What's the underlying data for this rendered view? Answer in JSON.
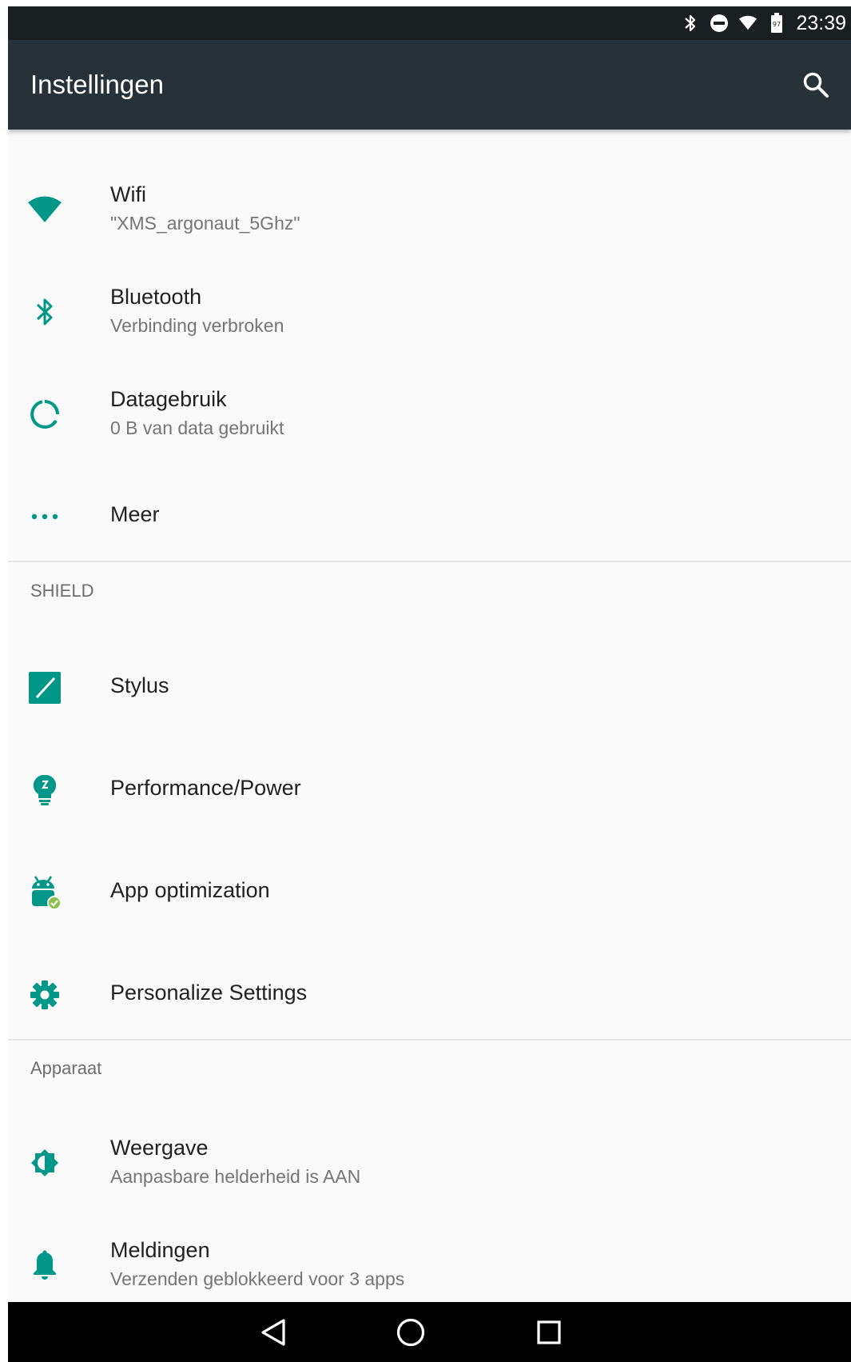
{
  "status_bar": {
    "time": "23:39",
    "icons": [
      "bluetooth-icon",
      "do-not-disturb-icon",
      "wifi-icon",
      "battery-icon"
    ]
  },
  "toolbar": {
    "title": "Instellingen",
    "search_icon": "search-icon"
  },
  "colors": {
    "accent": "#009688",
    "toolbar": "#263238",
    "status_bar": "#1a1f22"
  },
  "wireless": {
    "items": [
      {
        "title": "Wifi",
        "subtitle": "\"XMS_argonaut_5Ghz\"",
        "icon": "wifi-icon"
      },
      {
        "title": "Bluetooth",
        "subtitle": "Verbinding verbroken",
        "icon": "bluetooth-icon"
      },
      {
        "title": "Datagebruik",
        "subtitle": "0 B van data gebruikt",
        "icon": "data-usage-icon"
      },
      {
        "title": "Meer",
        "icon": "more-icon"
      }
    ]
  },
  "shield": {
    "header": "SHIELD",
    "items": [
      {
        "title": "Stylus",
        "icon": "stylus-icon"
      },
      {
        "title": "Performance/Power",
        "icon": "lightbulb-icon"
      },
      {
        "title": "App optimization",
        "icon": "android-check-icon"
      },
      {
        "title": "Personalize Settings",
        "icon": "gear-icon"
      }
    ]
  },
  "device": {
    "header": "Apparaat",
    "items": [
      {
        "title": "Weergave",
        "subtitle": "Aanpasbare helderheid is AAN",
        "icon": "brightness-icon"
      },
      {
        "title": "Meldingen",
        "subtitle": "Verzenden geblokkeerd voor 3 apps",
        "icon": "bell-icon"
      }
    ]
  },
  "nav_bar": {
    "buttons": [
      "back-icon",
      "home-icon",
      "recents-icon"
    ]
  }
}
